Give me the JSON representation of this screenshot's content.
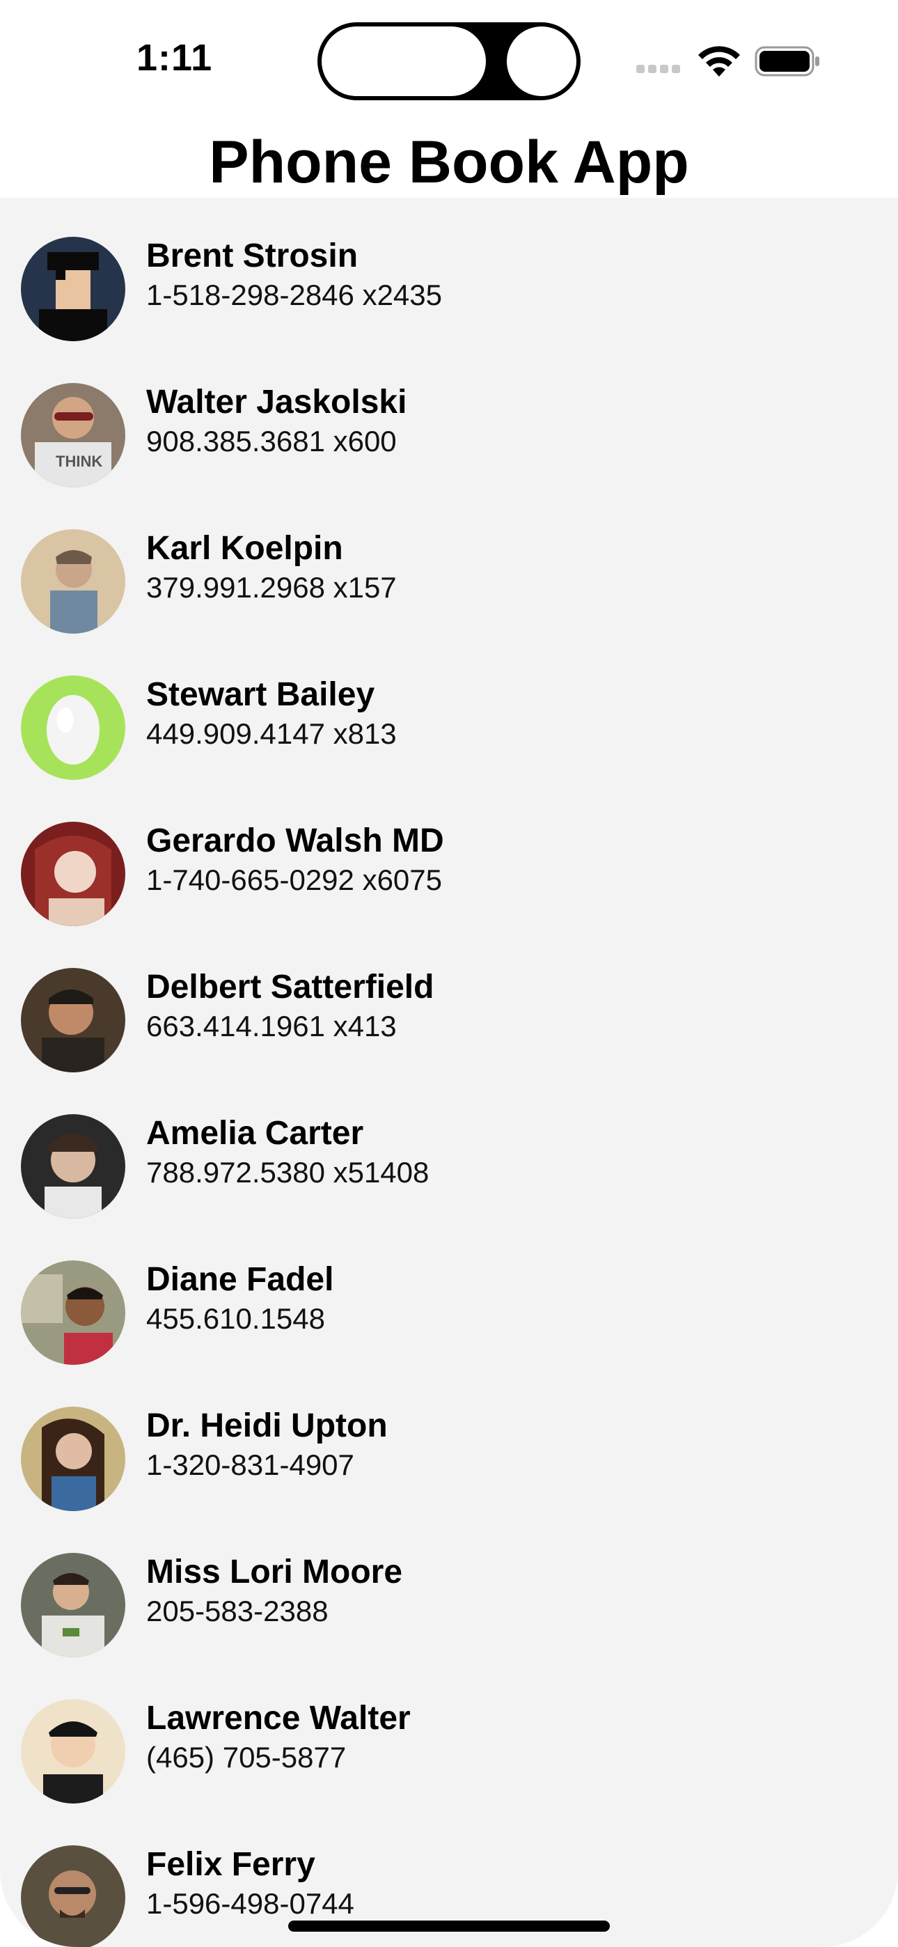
{
  "status_bar": {
    "time": "1:11"
  },
  "app": {
    "title": "Phone Book App"
  },
  "contacts": [
    {
      "name": "Brent Strosin",
      "phone": "1-518-298-2846 x2435",
      "avatar": "pixel-art-avatar"
    },
    {
      "name": "Walter Jaskolski",
      "phone": "908.385.3681 x600",
      "avatar": "photo-avatar"
    },
    {
      "name": "Karl Koelpin",
      "phone": "379.991.2968 x157",
      "avatar": "photo-avatar"
    },
    {
      "name": "Stewart Bailey",
      "phone": "449.909.4147 x813",
      "avatar": "egg-avatar"
    },
    {
      "name": "Gerardo Walsh MD",
      "phone": "1-740-665-0292 x6075",
      "avatar": "photo-avatar"
    },
    {
      "name": "Delbert Satterfield",
      "phone": "663.414.1961 x413",
      "avatar": "photo-avatar"
    },
    {
      "name": "Amelia Carter",
      "phone": "788.972.5380 x51408",
      "avatar": "photo-avatar"
    },
    {
      "name": "Diane Fadel",
      "phone": "455.610.1548",
      "avatar": "photo-avatar"
    },
    {
      "name": "Dr. Heidi Upton",
      "phone": "1-320-831-4907",
      "avatar": "photo-avatar"
    },
    {
      "name": "Miss Lori Moore",
      "phone": "205-583-2388",
      "avatar": "photo-avatar"
    },
    {
      "name": "Lawrence Walter",
      "phone": "(465) 705-5877",
      "avatar": "photo-avatar"
    },
    {
      "name": "Felix Ferry",
      "phone": "1-596-498-0744",
      "avatar": "photo-avatar"
    }
  ],
  "colors": {
    "list_background": "#f3f3f3",
    "egg_avatar_green": "#a7e35a"
  }
}
